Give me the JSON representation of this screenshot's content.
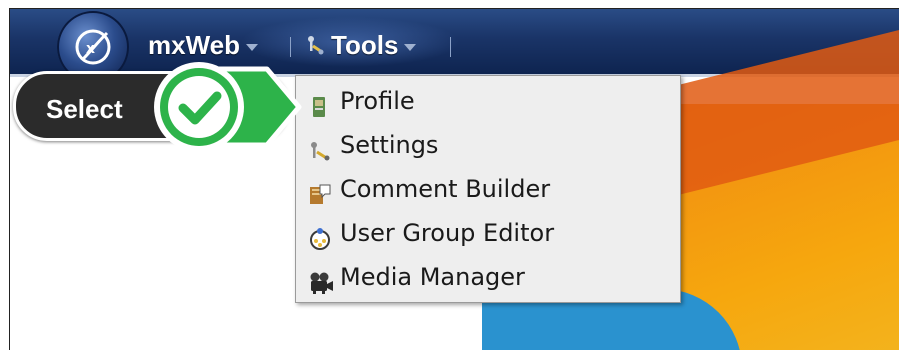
{
  "topbar": {
    "brand": "mxWeb",
    "tools": "Tools"
  },
  "select_badge": {
    "label": "Select"
  },
  "tools_menu": {
    "items": [
      {
        "label": "Profile",
        "icon": "profile-icon"
      },
      {
        "label": "Settings",
        "icon": "settings-icon"
      },
      {
        "label": "Comment Builder",
        "icon": "comment-builder-icon"
      },
      {
        "label": "User Group Editor",
        "icon": "user-group-icon"
      },
      {
        "label": "Media Manager",
        "icon": "media-manager-icon"
      }
    ]
  },
  "colors": {
    "topbar": "#1a3467",
    "menu_bg": "#eeeeee",
    "check_green": "#2db34a",
    "hero_orange": "#f29410"
  }
}
